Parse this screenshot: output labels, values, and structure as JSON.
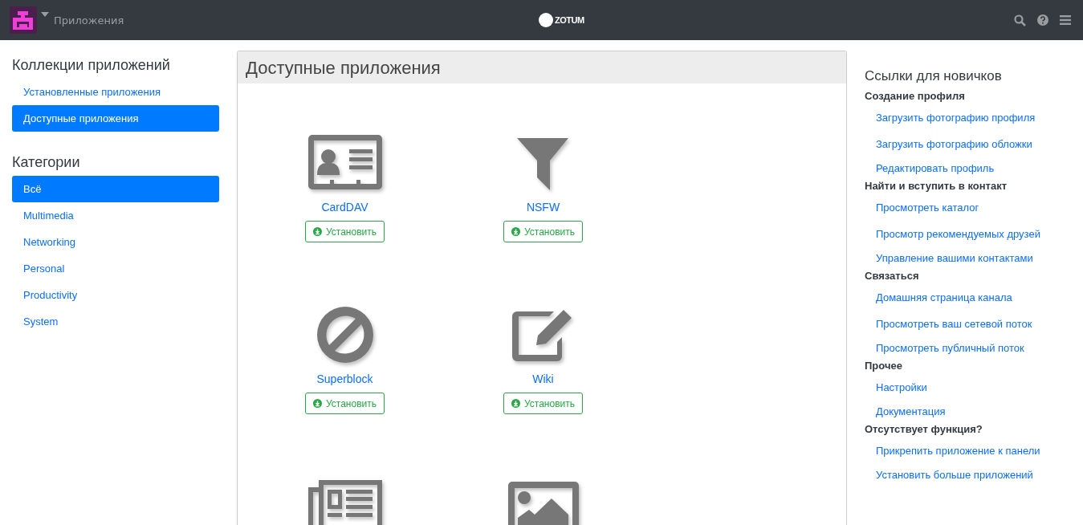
{
  "navbar": {
    "title": "Приложения",
    "logo_text": "ZOTUM"
  },
  "left": {
    "sections": [
      {
        "heading": "Коллекции приложений",
        "items": [
          {
            "label": "Установленные приложения",
            "selected": false
          },
          {
            "label": "Доступные приложения",
            "selected": true
          }
        ]
      },
      {
        "heading": "Категории",
        "items": [
          {
            "label": "Всё",
            "selected": true
          },
          {
            "label": "Multimedia",
            "selected": false
          },
          {
            "label": "Networking",
            "selected": false
          },
          {
            "label": "Personal",
            "selected": false
          },
          {
            "label": "Productivity",
            "selected": false
          },
          {
            "label": "System",
            "selected": false
          }
        ]
      }
    ]
  },
  "main": {
    "title": "Доступные приложения",
    "apps": [
      {
        "kind": "card",
        "name": "CardDAV",
        "button": "Установить"
      },
      {
        "kind": "filter",
        "name": "NSFW",
        "button": "Установить"
      },
      {
        "kind": "ban",
        "name": "Superblock",
        "button": "Установить"
      },
      {
        "kind": "edit",
        "name": "Wiki",
        "button": "Установить"
      },
      {
        "kind": "newspaper"
      },
      {
        "kind": "image"
      }
    ]
  },
  "right": {
    "title": "Ссылки для новичков",
    "groups": [
      {
        "heading": "Создание профиля",
        "links": [
          "Загрузить фотографию профиля",
          "Загрузить фотографию обложки",
          "Редактировать профиль"
        ]
      },
      {
        "heading": "Найти и вступить в контакт",
        "links": [
          "Просмотреть каталог",
          "Просмотр рекомендуемых друзей",
          "Управление вашими контактами"
        ]
      },
      {
        "heading": "Связаться",
        "links": [
          "Домашняя страница канала",
          "Просмотреть ваш сетевой поток",
          "Просмотреть публичный поток"
        ]
      },
      {
        "heading": "Прочее",
        "links": [
          "Настройки",
          "Документация"
        ]
      },
      {
        "heading": "Отсутствует функция?",
        "links": [
          "Прикрепить приложение к панели",
          "Установить больше приложений"
        ]
      }
    ]
  }
}
